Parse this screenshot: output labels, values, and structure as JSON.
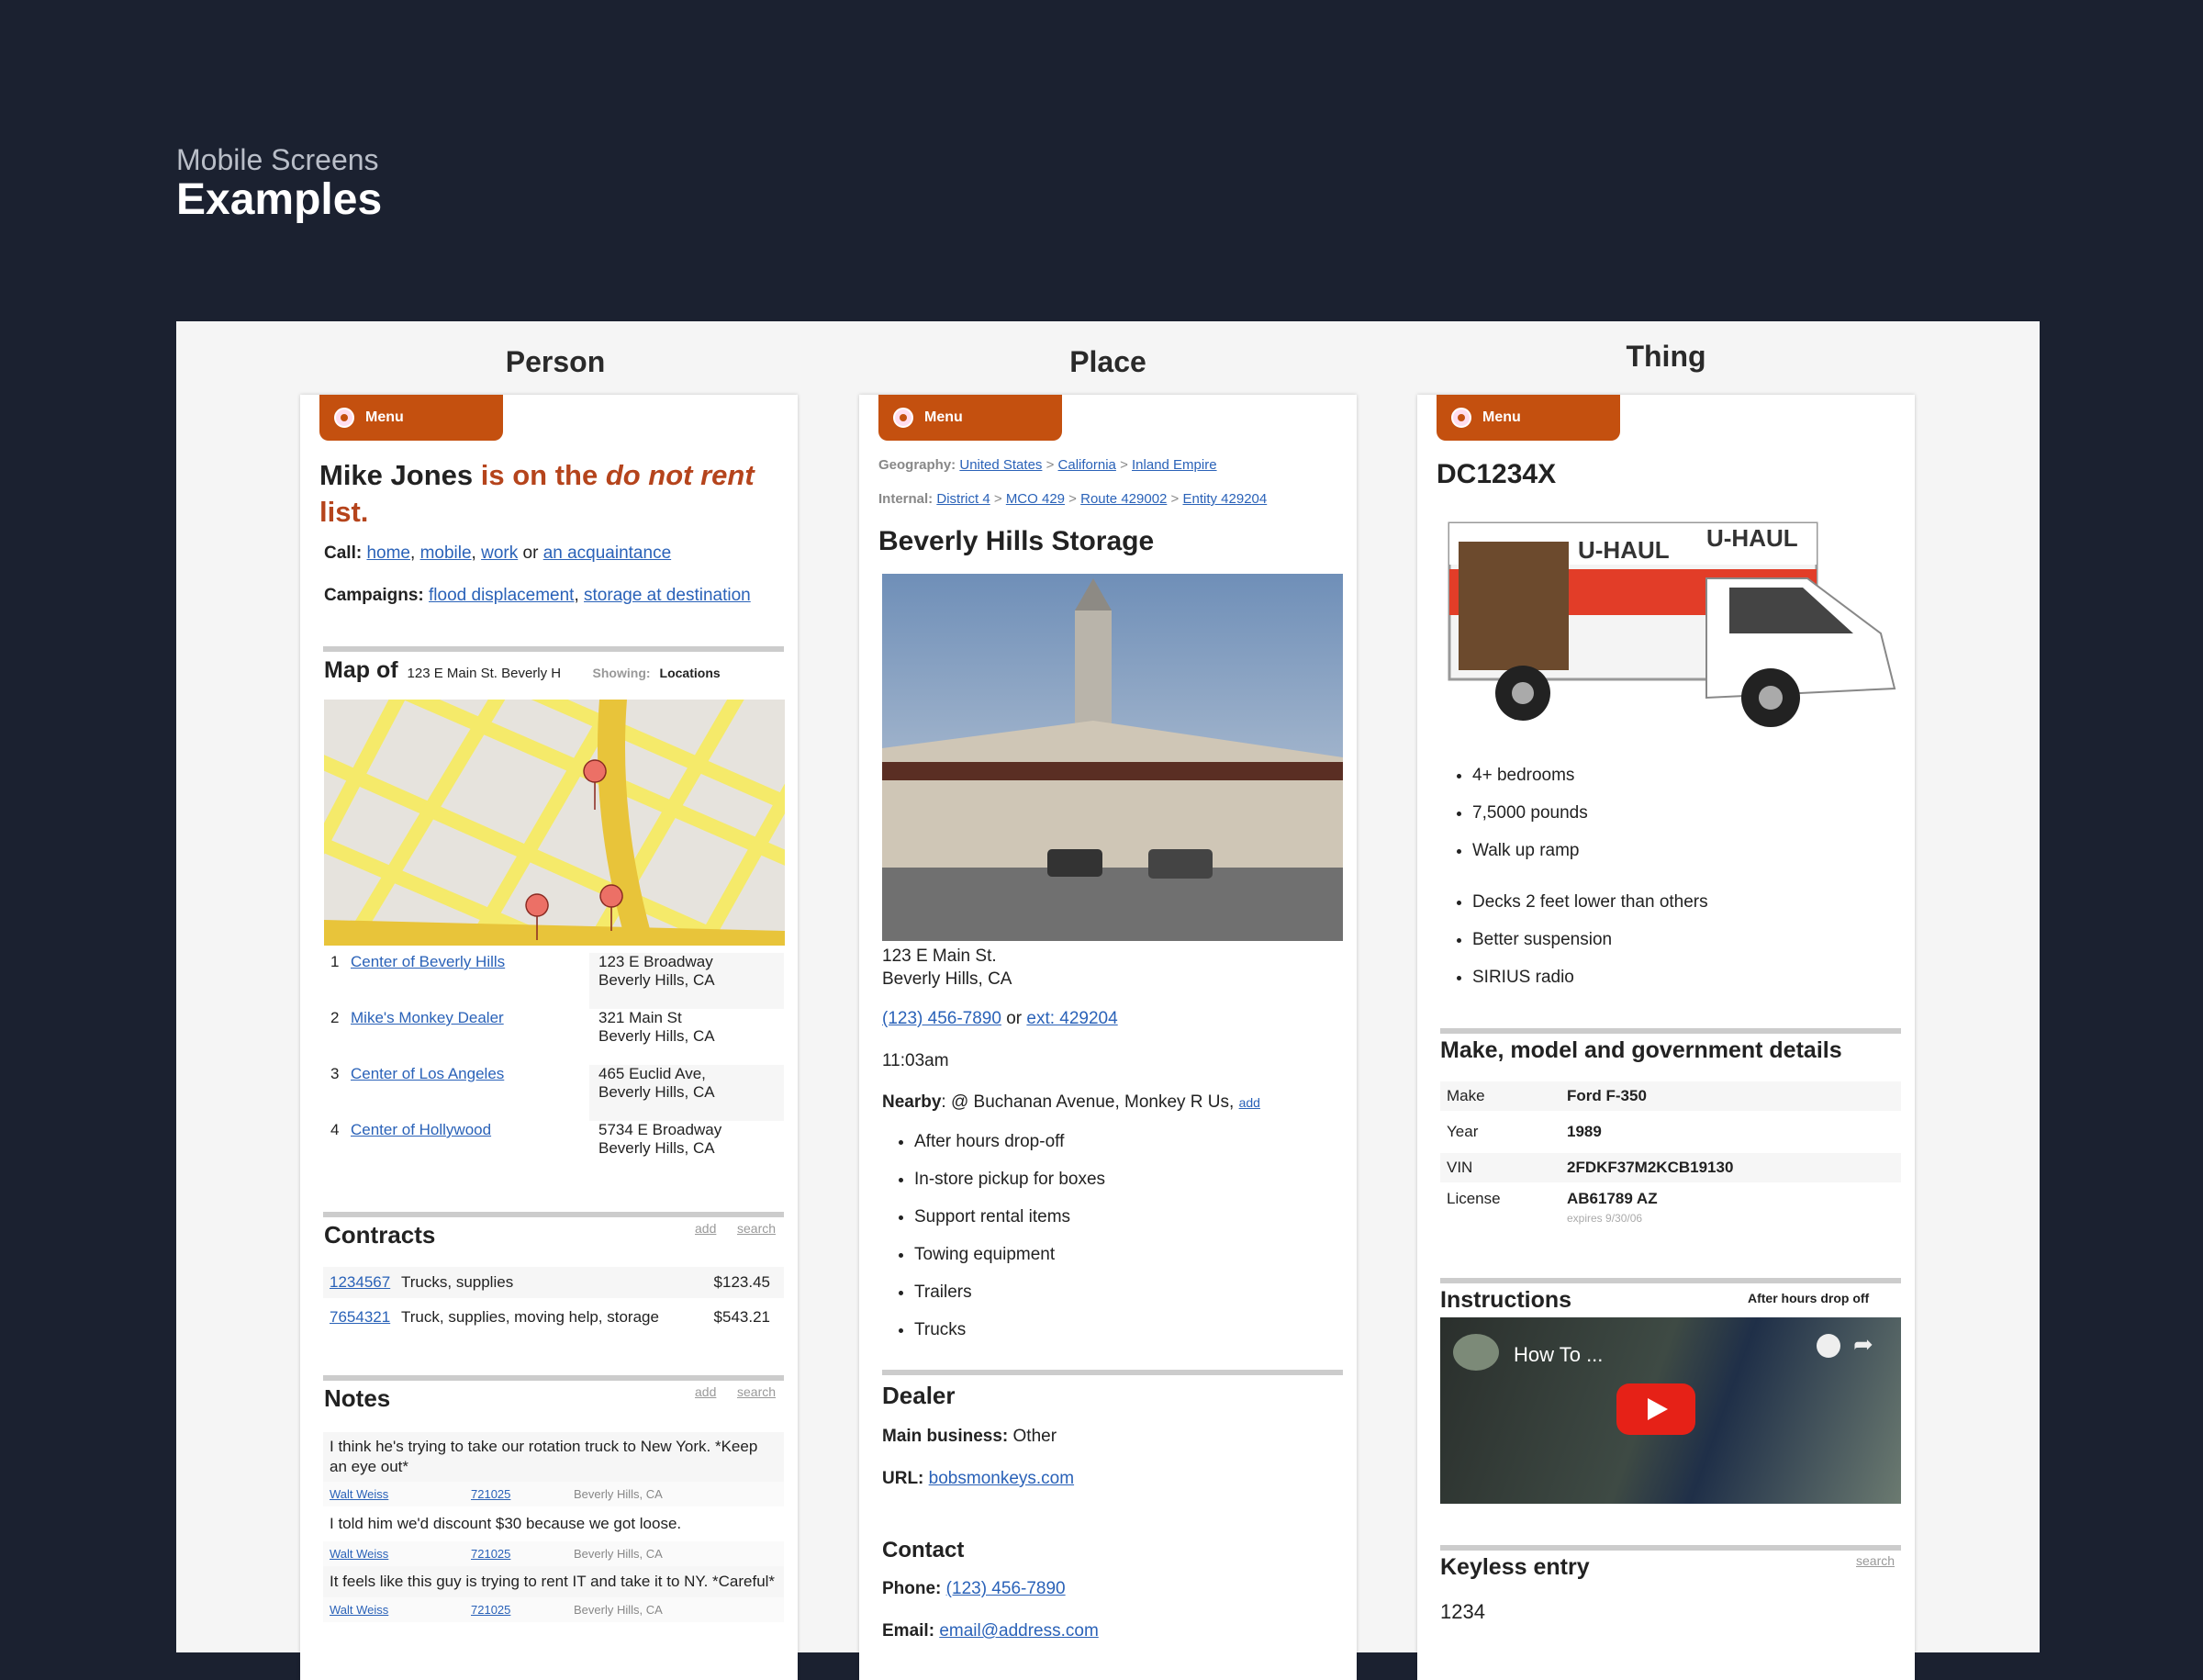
{
  "header": {
    "eyebrow": "Mobile Screens",
    "title": "Examples"
  },
  "columns": [
    "Person",
    "Place",
    "Thing"
  ],
  "menu_label": "Menu",
  "accent": "#c4500f",
  "person": {
    "name": "Mike Jones",
    "title_mid": " is on the ",
    "title_em": "do not rent",
    "title_end": " list.",
    "call_label": "Call:",
    "call_links": [
      "home",
      "mobile",
      "work"
    ],
    "call_or": " or ",
    "call_last": "an acquaintance",
    "campaigns_label": "Campaigns:",
    "campaigns": [
      "flood displacement",
      "storage at destination"
    ],
    "map_label": "Map of",
    "map_address": "123 E Main St. Beverly H",
    "showing_label": "Showing:",
    "showing_value": "Locations",
    "locations": [
      {
        "n": "1",
        "name": "Center of Beverly Hills",
        "addr1": "123 E Broadway",
        "addr2": "Beverly Hills, CA"
      },
      {
        "n": "2",
        "name": "Mike's Monkey Dealer",
        "addr1": "321 Main St",
        "addr2": "Beverly Hills, CA"
      },
      {
        "n": "3",
        "name": "Center of Los Angeles",
        "addr1": "465 Euclid Ave,",
        "addr2": "Beverly Hills, CA"
      },
      {
        "n": "4",
        "name": "Center of Hollywood",
        "addr1": "5734 E Broadway",
        "addr2": "Beverly Hills, CA"
      }
    ],
    "contracts_title": "Contracts",
    "add": "add",
    "search": "search",
    "contracts": [
      {
        "id": "1234567",
        "desc": "Trucks, supplies",
        "amount": "$123.45"
      },
      {
        "id": "7654321",
        "desc": "Truck, supplies, moving help, storage",
        "amount": "$543.21"
      }
    ],
    "notes_title": "Notes",
    "notes": [
      {
        "text": "I think he's trying to take our rotation truck to New York. *Keep an eye out*",
        "author": "Walt Weiss",
        "id": "721025",
        "place": "Beverly Hills, CA"
      },
      {
        "text": "I told him we'd discount $30 because we got loose.",
        "author": "Walt Weiss",
        "id": "721025",
        "place": "Beverly Hills, CA"
      },
      {
        "text": "It feels like this guy is trying to rent IT and take it to NY. *Careful*",
        "author": "Walt Weiss",
        "id": "721025",
        "place": "Beverly Hills, CA"
      }
    ]
  },
  "place": {
    "geo_label": "Geography:",
    "geo": [
      "United States",
      "California",
      "Inland Empire"
    ],
    "internal_label": "Internal:",
    "internal": [
      "District 4",
      "MCO 429",
      "Route 429002",
      "Entity 429204"
    ],
    "sep": " > ",
    "title": "Beverly Hills Storage",
    "addr1": "123 E Main St.",
    "addr2": "Beverly Hills, CA",
    "phone": "(123) 456-7890",
    "or": " or ",
    "ext": "ext: 429204",
    "time": "11:03am",
    "nearby_label": "Nearby",
    "nearby_text": ": @ Buchanan Avenue, Monkey R Us, ",
    "nearby_add": "add",
    "features": [
      "After hours drop-off",
      "In-store pickup for boxes",
      "Support rental items",
      "Towing equipment",
      "Trailers",
      "Trucks"
    ],
    "dealer_title": "Dealer",
    "main_business_label": "Main business:",
    "main_business": " Other",
    "url_label": "URL:",
    "url": "bobsmonkeys.com",
    "contact_title": "Contact",
    "phone_label": "Phone:",
    "contact_phone": "(123) 456-7890",
    "email_label": "Email:",
    "email": "email@address.com"
  },
  "thing": {
    "title": "DC1234X",
    "truck_brand": "U-HAUL",
    "features_a": [
      "4+ bedrooms",
      "7,5000 pounds",
      "Walk up ramp"
    ],
    "features_b": [
      "Decks 2 feet lower than others",
      "Better suspension",
      "SIRIUS radio"
    ],
    "details_title": "Make, model and government details",
    "details": [
      {
        "k": "Make",
        "v": "Ford F-350"
      },
      {
        "k": "Year",
        "v": "1989"
      },
      {
        "k": "VIN",
        "v": "2FDKF37M2KCB19130"
      },
      {
        "k": "License",
        "v": "AB61789 AZ",
        "sub": "expires 9/30/06"
      }
    ],
    "instructions_title": "Instructions",
    "instructions_note": "After hours drop off",
    "video_title": "How To ...",
    "keyless_title": "Keyless entry",
    "keyless_search": "search",
    "keyless_code": "1234"
  }
}
